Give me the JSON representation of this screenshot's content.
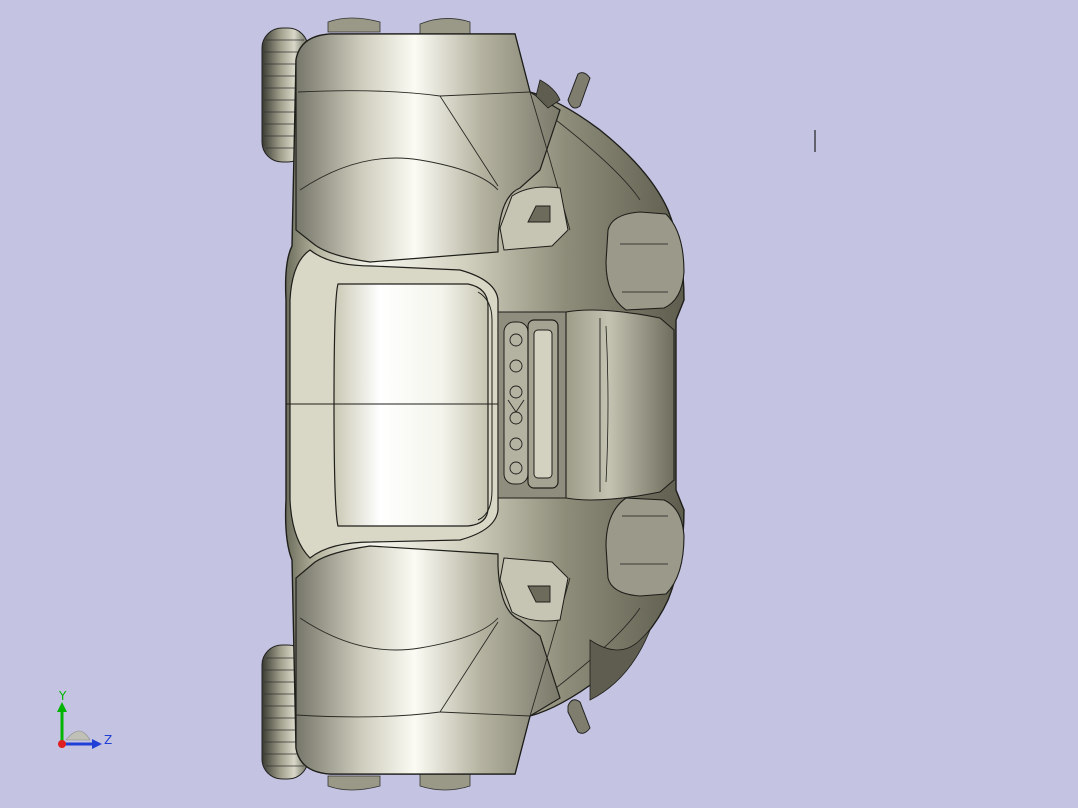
{
  "viewport": {
    "background": "#c4c4e2",
    "model": "atv-3d-model-top-view"
  },
  "triad": {
    "y_label": "Y",
    "z_label": "Z",
    "colors": {
      "y": "#00b400",
      "z": "#1f3fd6",
      "x": "#e02020"
    }
  },
  "cursor": {
    "name": "text-cursor-icon"
  }
}
